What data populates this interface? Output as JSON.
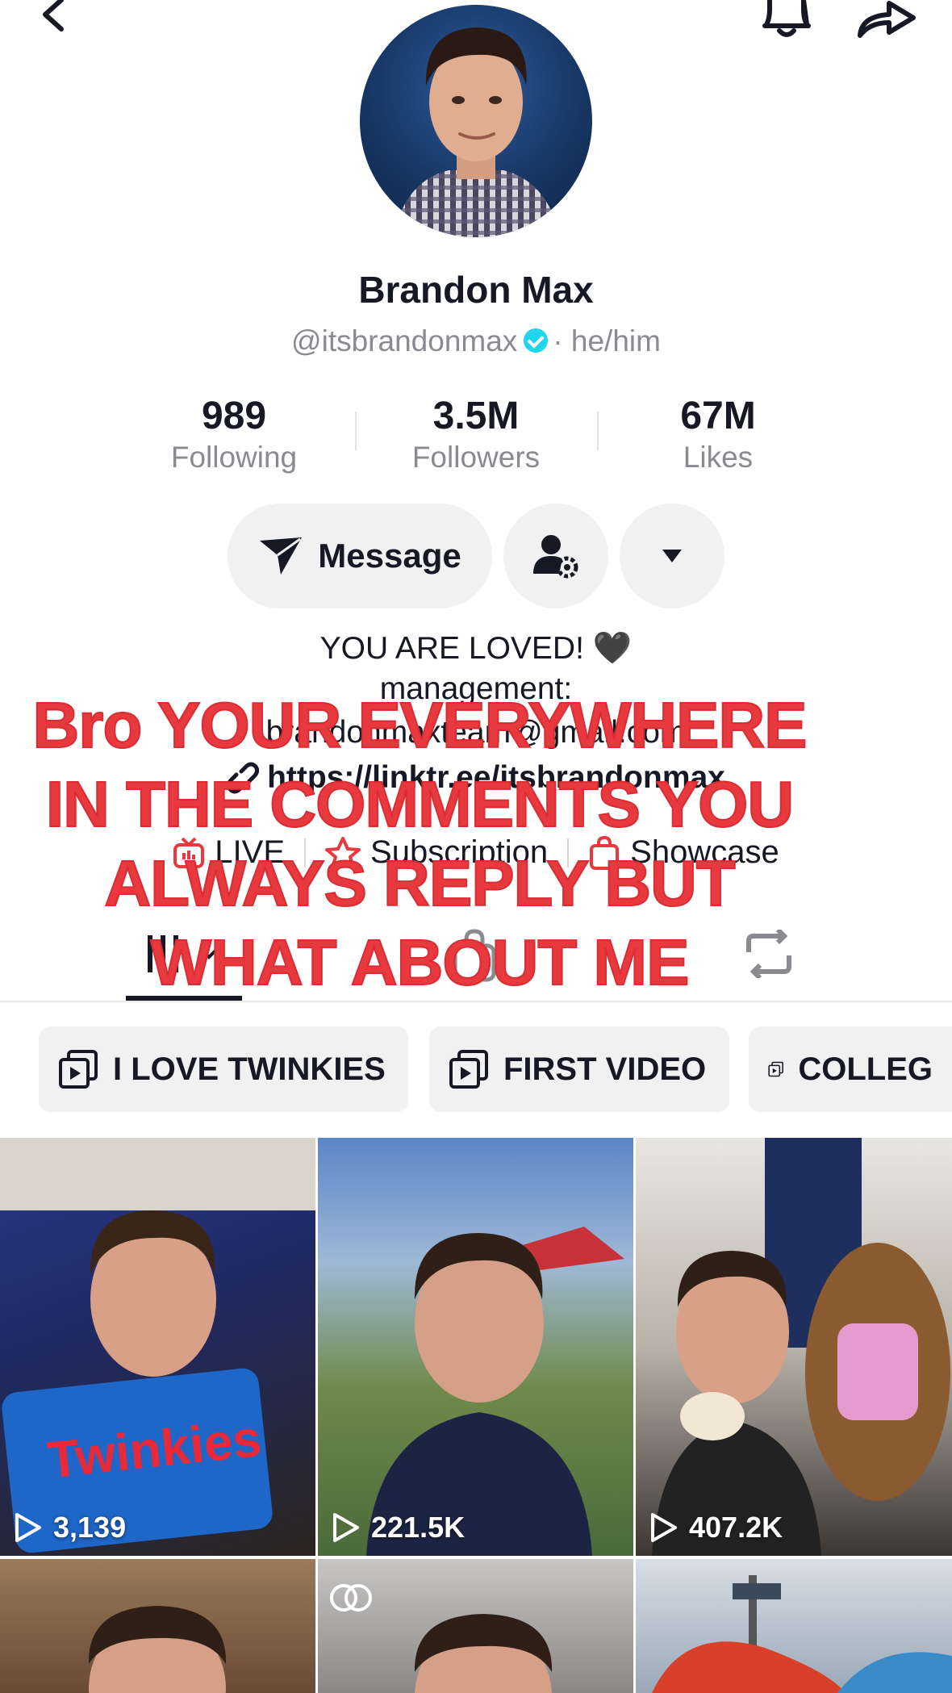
{
  "header": {
    "back_icon": "back-icon",
    "bell_icon": "bell-icon",
    "share_icon": "share-icon"
  },
  "profile": {
    "name": "Brandon Max",
    "handle": "@itsbrandonmax",
    "pronouns": "· he/him",
    "avatar": "avatar"
  },
  "stats": [
    {
      "value": "989",
      "label": "Following"
    },
    {
      "value": "3.5M",
      "label": "Followers"
    },
    {
      "value": "67M",
      "label": "Likes"
    }
  ],
  "actions": {
    "message_label": "Message",
    "add_friend_icon": "person-gear-icon",
    "more_icon": "caret-down-icon"
  },
  "bio": {
    "line1": "YOU ARE LOVED! 🖤",
    "line2": "management:",
    "line3": "brandonmaxteam@gmail.com",
    "link": "https://linktr.ee/itsbrandonmax"
  },
  "tools": [
    {
      "label": "LIVE",
      "icon": "live-tv-icon"
    },
    {
      "label": "Subscription",
      "icon": "star-icon"
    },
    {
      "label": "Showcase",
      "icon": "shopping-bag-icon"
    }
  ],
  "playlists": [
    {
      "label": "I LOVE TWINKIES"
    },
    {
      "label": "FIRST VIDEO"
    },
    {
      "label": "COLLEG"
    }
  ],
  "videos": [
    {
      "views": "3,139"
    },
    {
      "views": "221.5K"
    },
    {
      "views": "407.2K"
    }
  ],
  "overlay": {
    "line1": "Bro YOUR EVERYWHERE",
    "line2": "IN THE COMMENTS YOU",
    "line3": "ALWAYS REPLY BUT",
    "line4": "WHAT ABOUT ME"
  },
  "colors": {
    "accent_red": "#e8393f",
    "verified": "#20d5ec",
    "pill_bg": "#f1f1f2"
  }
}
